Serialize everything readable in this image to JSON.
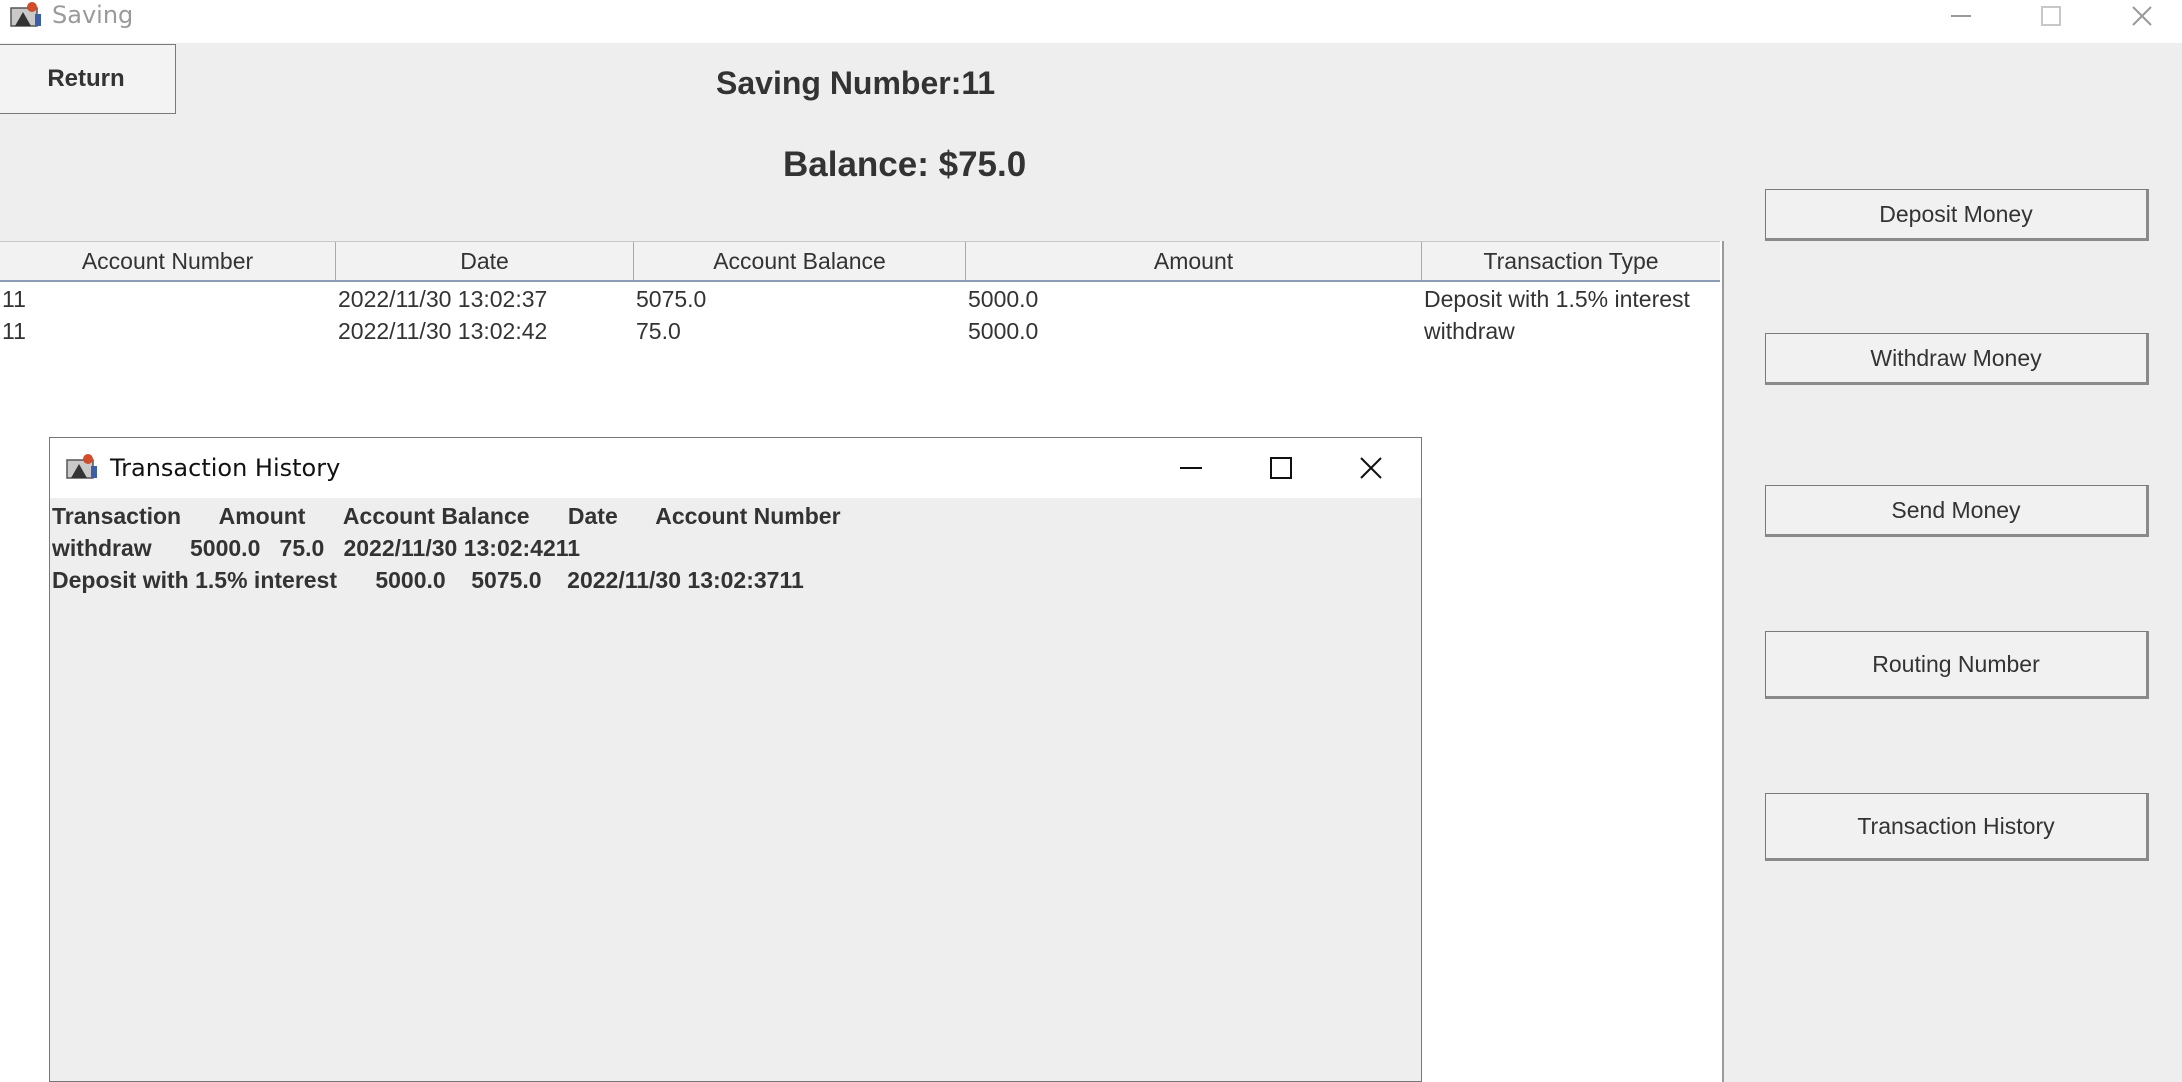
{
  "window": {
    "title": "Saving",
    "icon": "java-app-icon"
  },
  "header": {
    "return_label": "Return",
    "saving_number": "Saving Number:11",
    "balance": "Balance: $75.0"
  },
  "table": {
    "columns": [
      "Account Number",
      "Date",
      "Account Balance",
      "Amount",
      "Transaction Type"
    ],
    "rows": [
      [
        "11",
        "2022/11/30 13:02:37",
        "5075.0",
        "5000.0",
        "Deposit with 1.5% interest"
      ],
      [
        "11",
        "2022/11/30 13:02:42",
        "75.0",
        "5000.0",
        "withdraw"
      ]
    ]
  },
  "sidebar": {
    "buttons": [
      "Deposit Money",
      "Withdraw Money",
      "Send Money",
      "Routing Number",
      "Transaction History"
    ]
  },
  "history_window": {
    "title": "Transaction History",
    "lines": [
      "Transaction      Amount      Account Balance      Date      Account Number",
      "withdraw      5000.0   75.0   2022/11/30 13:02:4211",
      "Deposit with 1.5% interest      5000.0    5075.0    2022/11/30 13:02:3711"
    ]
  }
}
